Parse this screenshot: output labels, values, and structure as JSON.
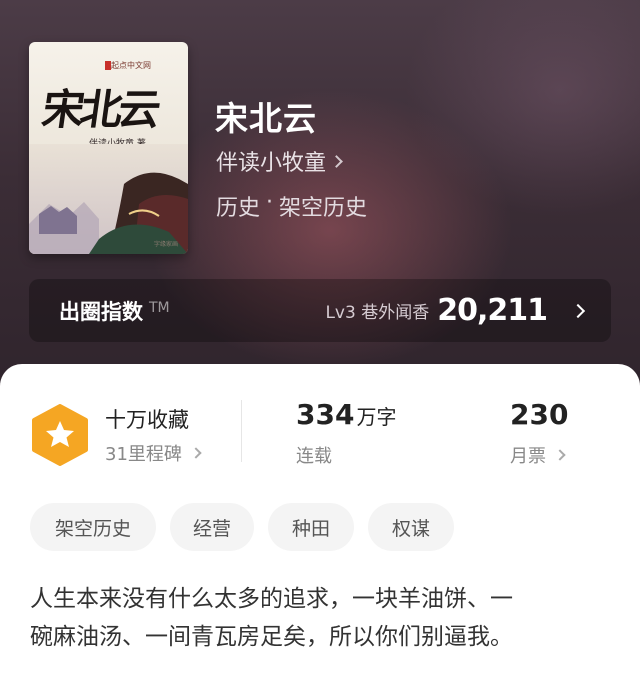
{
  "book": {
    "title": "宋北云",
    "author": "伴读小牧童",
    "genre": "历史",
    "genre_separator": "·",
    "subgenre": "架空历史",
    "cover": {
      "title_text": "宋北云",
      "publisher_text": "起点中文网",
      "author_text": "伴读小牧童 著",
      "small_text": "字缘家画"
    }
  },
  "index_bar": {
    "label": "出圈指数",
    "tm": "TM",
    "level": "Lv3 巷外闻香",
    "value": "20,211"
  },
  "stats": {
    "collect_title": "十万收藏",
    "collect_sub": "31里程碑",
    "words_value": "334",
    "words_unit": "万字",
    "words_label": "连载",
    "tickets_value": "230",
    "tickets_label": "月票"
  },
  "tags": [
    "架空历史",
    "经营",
    "种田",
    "权谋"
  ],
  "description_line1": "人生本来没有什么太多的追求，一块羊油饼、一",
  "description_line2": "碗麻油汤、一间青瓦房足矣，所以你们别逼我。",
  "colors": {
    "badge_orange": "#f5a623",
    "hero_bg": "#3b2d36"
  },
  "icons": {
    "badge": "star-hexagon-icon",
    "chevron": "chevron-right-icon"
  }
}
